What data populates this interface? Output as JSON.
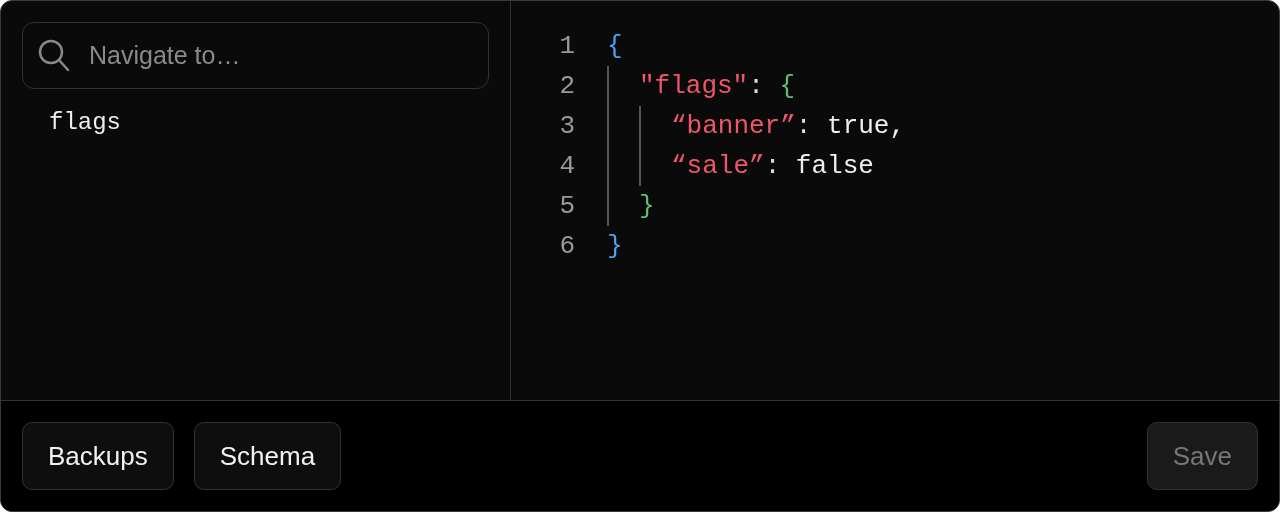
{
  "search": {
    "placeholder": "Navigate to…"
  },
  "tree": [
    {
      "label": "flags",
      "selected": false
    }
  ],
  "code": [
    {
      "number": "1",
      "tokens": [
        {
          "kind": "bracket-1",
          "text": "{"
        }
      ],
      "children": [
        {
          "number": "2",
          "tokens": [
            {
              "kind": "key",
              "text": "\"flags\""
            },
            {
              "kind": "punct",
              "text": ": "
            },
            {
              "kind": "bracket-2",
              "text": "{"
            }
          ],
          "children": [
            {
              "number": "3",
              "tokens": [
                {
                  "kind": "key",
                  "text": "“banner”"
                },
                {
                  "kind": "punct",
                  "text": ": "
                },
                {
                  "kind": "value",
                  "text": "true,"
                }
              ]
            },
            {
              "number": "4",
              "tokens": [
                {
                  "kind": "key",
                  "text": "“sale”"
                },
                {
                  "kind": "punct",
                  "text": ": "
                },
                {
                  "kind": "value",
                  "text": "false"
                }
              ]
            }
          ]
        },
        {
          "number": "5",
          "tokens": [
            {
              "kind": "bracket-2",
              "text": "}"
            }
          ]
        }
      ]
    },
    {
      "number": "6",
      "tokens": [
        {
          "kind": "bracket-1",
          "text": "}"
        }
      ]
    }
  ],
  "buttons": [
    {
      "label": "Backups",
      "disabled": false
    },
    {
      "label": "Schema",
      "disabled": false
    }
  ],
  "save": {
    "label": "Save",
    "disabled": true
  }
}
